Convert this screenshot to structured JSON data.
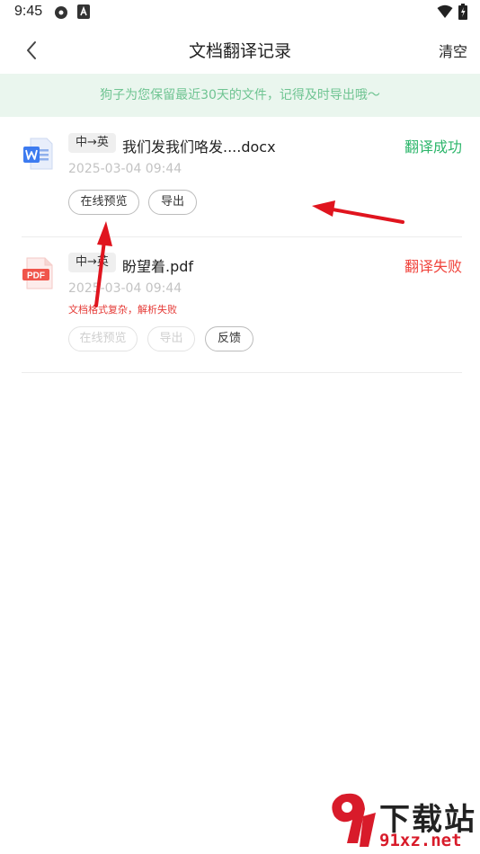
{
  "status_bar": {
    "time": "9:45"
  },
  "header": {
    "title": "文档翻译记录",
    "clear_label": "清空"
  },
  "notice": "狗子为您保留最近30天的文件，记得及时导出哦～",
  "records": [
    {
      "file_type": "word",
      "lang": "中→英",
      "name": "我们发我们咯发....docx",
      "status": "翻译成功",
      "time": "2025-03-04 09:44",
      "actions": [
        "在线预览",
        "导出"
      ]
    },
    {
      "file_type": "pdf",
      "file_icon_text": "PDF",
      "lang": "中→英",
      "name": "盼望着.pdf",
      "status": "翻译失败",
      "time": "2025-03-04 09:44",
      "error": "文档格式复杂，解析失败",
      "actions": [
        "在线预览",
        "导出",
        "反馈"
      ]
    }
  ],
  "watermark": {
    "line1": "下载站",
    "line2": "91xz.net"
  },
  "colors": {
    "success": "#2db66b",
    "fail": "#f0443c",
    "notice_bg": "#eaf6ee",
    "notice_text": "#6fc492",
    "annotation_arrow": "#e0141e"
  }
}
